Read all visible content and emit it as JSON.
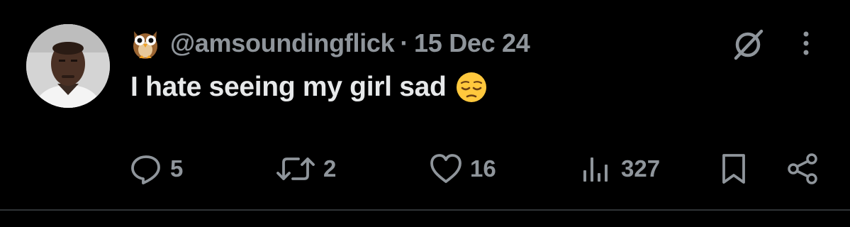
{
  "tweet": {
    "handle": "@amsoundingflick",
    "separator": "·",
    "date": "15 Dec 24",
    "text": "I hate seeing my girl sad",
    "emoji_icon": "pensive-face-emoji",
    "name_badge_icon": "owl-emoji"
  },
  "actions": {
    "reply_count": "5",
    "retweet_count": "2",
    "like_count": "16",
    "views_count": "327"
  },
  "colors": {
    "background": "#000000",
    "text_primary": "#e7e9ea",
    "text_secondary": "#8f959b",
    "divider": "#2f3336"
  }
}
